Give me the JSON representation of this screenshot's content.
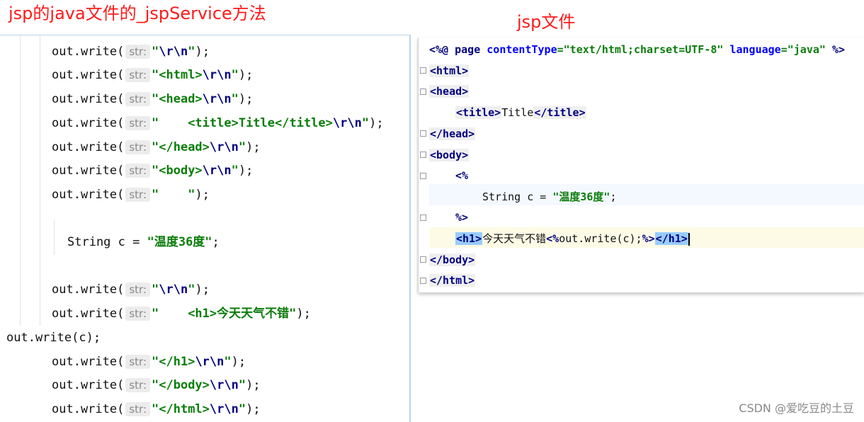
{
  "captions": {
    "left": "jsp的java文件的_jspService方法",
    "right": "jsp文件"
  },
  "servlet": {
    "call": "out.write(",
    "hint": "str:",
    "close": ");",
    "lines": [
      {
        "str": "\"",
        "esc": "\\r\\n",
        "end": "\""
      },
      {
        "str": "\"<html>",
        "esc": "\\r\\n",
        "end": "\""
      },
      {
        "str": "\"<head>",
        "esc": "\\r\\n",
        "end": "\""
      },
      {
        "str": "\"    <title>Title</title>",
        "esc": "\\r\\n",
        "end": "\""
      },
      {
        "str": "\"</head>",
        "esc": "\\r\\n",
        "end": "\""
      },
      {
        "str": "\"<body>",
        "esc": "\\r\\n",
        "end": "\""
      },
      {
        "str": "\"    \"",
        "esc": "",
        "end": ""
      }
    ],
    "scriptlet_code": "String c = ",
    "scriptlet_value": "\"温度36度\"",
    "scriptlet_end": ";",
    "lines_after": [
      {
        "str": "\"",
        "esc": "\\r\\n",
        "end": "\""
      },
      {
        "str": "\"    <h1>今天天气不错\"",
        "esc": "",
        "end": ""
      }
    ],
    "direct_write": "out.write(c);",
    "lines_tail": [
      {
        "str": "\"</h1>",
        "esc": "\\r\\n",
        "end": "\""
      },
      {
        "str": "\"</body>",
        "esc": "\\r\\n",
        "end": "\""
      },
      {
        "str": "\"</html>",
        "esc": "\\r\\n",
        "end": "\""
      }
    ]
  },
  "jsp": {
    "directive": {
      "open": "<%@ ",
      "page": "page ",
      "ct_attr": "contentType",
      "ct_val": "=\"text/html;charset=UTF-8\"",
      "lang_attr": " language",
      "lang_val": "=\"java\"",
      "close": " %>"
    },
    "html_open": "<html>",
    "head_open": "<head>",
    "title_open": "<title>",
    "title_text": "Title",
    "title_close": "</title>",
    "head_close": "</head>",
    "body_open": "<body>",
    "scriptlet_open": "<%",
    "scriptlet_code": "String c = ",
    "scriptlet_value": "\"温度36度\"",
    "scriptlet_end": ";",
    "scriptlet_close": "%>",
    "h1_open": "<h1>",
    "h1_text": "今天天气不错",
    "expr_open": "<%",
    "expr_code": "out.write(c);",
    "expr_close": "%>",
    "h1_close": "</h1>",
    "body_close": "</body>",
    "html_close": "</html>"
  },
  "watermark": "CSDN @爱吃豆的土豆"
}
